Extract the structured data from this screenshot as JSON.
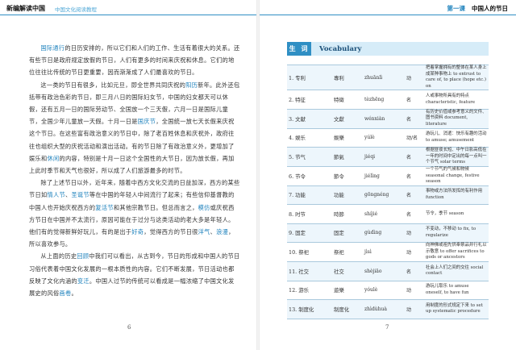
{
  "header": {
    "book_title": "新编解读中国",
    "series": "中国文化阅读教程",
    "unit": "第一课",
    "chapter": "中国人的节日"
  },
  "left_page": {
    "paragraphs": [
      [
        {
          "t": "国际通行",
          "k": true
        },
        {
          "t": "的日历安排的，所以它们和人们的工作、生活有着很大的关系。还有些节日是政府规定放假的节日，人们有更多的时间来庆祝和休息。它们的地位往往比传统的节日更重要，因而渐渐成了人们最喜欢的节日。"
        }
      ],
      [
        {
          "t": "这一类的节日有很多，比如元旦，即全世界共同庆祝的"
        },
        {
          "t": "阳历",
          "k": true
        },
        {
          "t": "新年。此外还包括带有政治色彩的节日，即三月八日的国际妇女节，中国的妇女都天可以休假，还有五月一日的国际劳动节、全国放一个三天假，六月一日是国际儿童节，全国少年儿童放一天假。十月一日是"
        },
        {
          "t": "国庆节",
          "k": true
        },
        {
          "t": "，全国统一放七天长假来庆祝这个节日。在这些富有政治意义的节日中，除了老百姓休息和庆祝外，政府往往也组织大型的庆祝活动和演出活动。有的节日除了有政治意义外，更增加了娱乐和"
        },
        {
          "t": "休闲",
          "k": true
        },
        {
          "t": "的内容，特别是十月一日这个全国性的大节日，因为放长假，再加上此时季节和天气也很好，所以成了人们旅游最多的时节。"
        }
      ],
      [
        {
          "t": "除了上述节日以外，近年来，随着中西方文化交流的日益加深，西方的某些节日如"
        },
        {
          "t": "情人节",
          "k": true
        },
        {
          "t": "、"
        },
        {
          "t": "圣诞节",
          "k": true
        },
        {
          "t": "等在中国的年轻人中间流行了起来；有些信仰基督教的中国人也开始庆祝西方的"
        },
        {
          "t": "复活节",
          "k": true
        },
        {
          "t": "和其他宗教节日。但总而言之，"
        },
        {
          "t": "模仿",
          "k": true
        },
        {
          "t": "或庆祝西方节日在中国并不太流行，原因可能在于过分与这类活动的老大多是年轻人。他们有的觉得新鲜好玩儿，有的是出于"
        },
        {
          "t": "好奇",
          "k": true
        },
        {
          "t": "，觉得西方的节日很"
        },
        {
          "t": "洋气",
          "k": true
        },
        {
          "t": "、"
        },
        {
          "t": "浪漫",
          "k": true
        },
        {
          "t": "，所以喜欢参与。"
        }
      ],
      [
        {
          "t": "从上面的历史"
        },
        {
          "t": "回顾",
          "k": true
        },
        {
          "t": "中我们可以看出，从古到今，节日的形成和中国人的节日习俗代表着中国文化发展的一根本质性的内容。它们不断发展，节日活动也都反映了文化内涵的"
        },
        {
          "t": "变迁",
          "k": true
        },
        {
          "t": "。中国人过节的传统可以看成是一幅浓缩了中国文化发展史的风俗"
        },
        {
          "t": "画卷",
          "k": true
        },
        {
          "t": "。"
        }
      ]
    ],
    "page_number": "6"
  },
  "right_page": {
    "vocab_label_zh": "生 词",
    "vocab_label_en": "Vocabulary",
    "vocab": [
      {
        "no": "1.",
        "word": "专利",
        "trad": "專利",
        "pinyin": "zhuānlì",
        "pos": "动",
        "def_zh": "把着掌握拥有的整体在某人身上成某种事物上",
        "def_en": "to entrust to care of, to place (hope etc.) on"
      },
      {
        "no": "2.",
        "word": "特征",
        "trad": "特徵",
        "pinyin": "tèzhēng",
        "pos": "名",
        "def_zh": "人或事物所具有的特点",
        "def_en": "characteristic, feature"
      },
      {
        "no": "3.",
        "word": "文献",
        "trad": "文獻",
        "pinyin": "wénxiàn",
        "pos": "名",
        "def_zh": "有历史价值或参考意义的文件、图书资料",
        "def_en": "document, literature"
      },
      {
        "no": "4.",
        "word": "娱乐",
        "trad": "娛樂",
        "pinyin": "yúlè",
        "pos": "动/名",
        "def_zh": "游玩儿、消遣：快乐有趣的活动",
        "def_en": "to amuse; amusement"
      },
      {
        "no": "5.",
        "word": "节气",
        "trad": "節氣",
        "pinyin": "jiéqi",
        "pos": "名",
        "def_zh": "根据昼夜长短、中午日影高低在一年的时间中定出的每一点叫一个节气",
        "def_en": "solar terms"
      },
      {
        "no": "6.",
        "word": "节令",
        "trad": "節令",
        "pinyin": "jiélìng",
        "pos": "名",
        "def_zh": "一个节气的气候和物候",
        "def_en": "seasonal change, festive season"
      },
      {
        "no": "7.",
        "word": "功能",
        "trad": "功能",
        "pinyin": "gōngnéng",
        "pos": "名",
        "def_zh": "事物或方法所发挥的有利作用",
        "def_en": "function"
      },
      {
        "no": "8.",
        "word": "时节",
        "trad": "時節",
        "pinyin": "shíjié",
        "pos": "名",
        "def_zh": "节令，季节",
        "def_en": "season"
      },
      {
        "no": "9.",
        "word": "固定",
        "trad": "固定",
        "pinyin": "gùdìng",
        "pos": "动",
        "def_zh": "不变动，不移动",
        "def_en": "to fix, to regularize"
      },
      {
        "no": "10.",
        "word": "祭祀",
        "trad": "祭祀",
        "pinyin": "jìsì",
        "pos": "动",
        "def_zh": "向神佛或祖先供奉祭品并行礼以示敬意",
        "def_en": "to offer sacrifices to gods or ancestors"
      },
      {
        "no": "11.",
        "word": "社交",
        "trad": "社交",
        "pinyin": "shèjiāo",
        "pos": "名",
        "def_zh": "社会上人们之间的交往",
        "def_en": "social contact"
      },
      {
        "no": "12.",
        "word": "游乐",
        "trad": "遊樂",
        "pinyin": "yóulè",
        "pos": "动",
        "def_zh": "游玩儿取乐",
        "def_en": "to amuse oneself, to have fun"
      },
      {
        "no": "13.",
        "word": "制度化",
        "trad": "制度化",
        "pinyin": "zhìdùhuà",
        "pos": "动",
        "def_zh": "用制度的形式规定下来",
        "def_en": "to set up systematic procedure"
      }
    ],
    "page_number": "7"
  }
}
